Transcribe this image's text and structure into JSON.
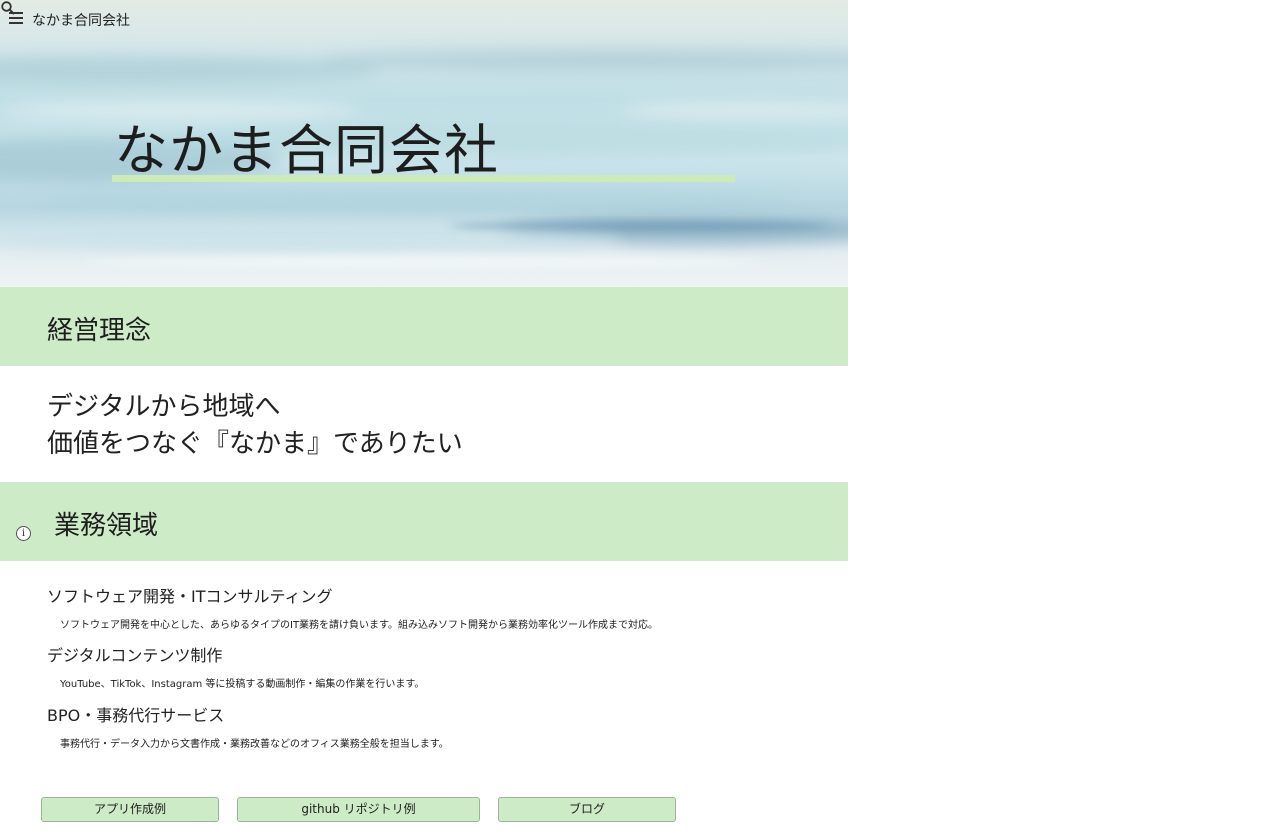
{
  "header": {
    "site_title": "なかま合同会社",
    "menu_icon": "hamburger-menu-icon",
    "search_icon": "search-icon"
  },
  "hero": {
    "title": "なかま合同会社",
    "underline_color": "#cdebb9"
  },
  "philosophy": {
    "heading": "経営理念",
    "line1": "デジタルから地域へ",
    "line2": "価値をつなぐ『なかま』でありたい"
  },
  "business": {
    "heading": "業務領域",
    "info_icon": "info-icon",
    "services": [
      {
        "title": "ソフトウェア開発・ITコンサルティング",
        "description": "ソフトウェア開発を中心とした、あらゆるタイプのIT業務を請け負います。組み込みソフト開発から業務効率化ツール作成まで対応。"
      },
      {
        "title": "デジタルコンテンツ制作",
        "description": "YouTube、TikTok、Instagram 等に投稿する動画制作・編集の作業を行います。"
      },
      {
        "title": "BPO・事務代行サービス",
        "description": "事務代行・データ入力から文書作成・業務改善などのオフィス業務全般を担当します。"
      }
    ]
  },
  "buttons": {
    "apps": "アプリ作成例",
    "github": "github リポジトリ例",
    "blog": "ブログ"
  },
  "colors": {
    "band": "#cdebc6",
    "text": "#212121"
  }
}
